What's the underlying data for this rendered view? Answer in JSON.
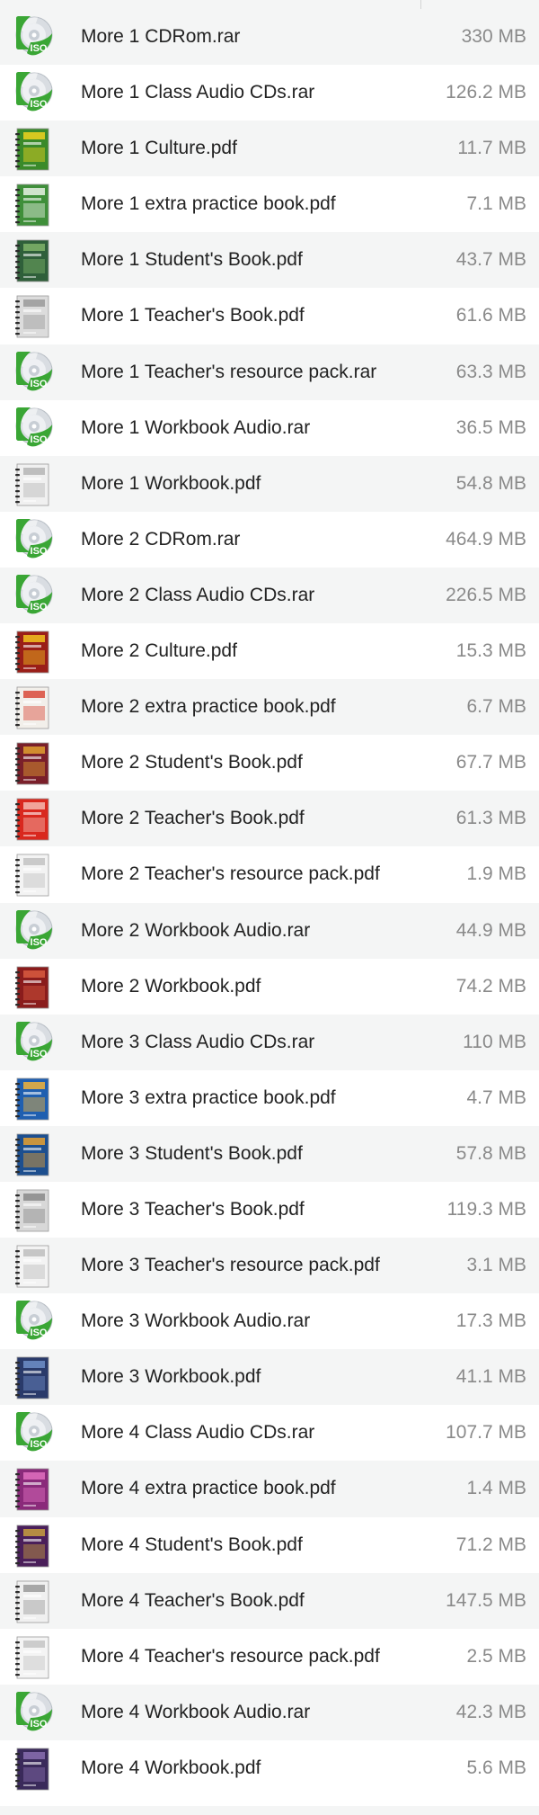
{
  "files": [
    {
      "name": "More 1 CDRom.rar",
      "size": "330 MB",
      "icon": "iso-disc-icon",
      "kind": "iso"
    },
    {
      "name": "More 1 Class Audio CDs.rar",
      "size": "126.2 MB",
      "icon": "iso-disc-icon",
      "kind": "iso"
    },
    {
      "name": "More 1 Culture.pdf",
      "size": "11.7 MB",
      "icon": "pdf-thumbnail-icon",
      "kind": "pdf",
      "color": "#3a8a2a",
      "accent": "#f2d21e"
    },
    {
      "name": "More 1 extra practice book.pdf",
      "size": "7.1 MB",
      "icon": "pdf-thumbnail-icon",
      "kind": "pdf",
      "color": "#3f8f3a",
      "accent": "#e9f2e6"
    },
    {
      "name": "More 1 Student's Book.pdf",
      "size": "43.7 MB",
      "icon": "pdf-thumbnail-icon",
      "kind": "pdf",
      "color": "#2f5f3a",
      "accent": "#7fb36a"
    },
    {
      "name": "More 1 Teacher's Book.pdf",
      "size": "61.6 MB",
      "icon": "pdf-thumbnail-icon",
      "kind": "pdf",
      "color": "#dcdcdc",
      "accent": "#9a9a9a"
    },
    {
      "name": "More 1 Teacher's resource pack.rar",
      "size": "63.3 MB",
      "icon": "iso-disc-icon",
      "kind": "iso"
    },
    {
      "name": "More 1 Workbook Audio.rar",
      "size": "36.5 MB",
      "icon": "iso-disc-icon",
      "kind": "iso"
    },
    {
      "name": "More 1 Workbook.pdf",
      "size": "54.8 MB",
      "icon": "pdf-thumbnail-icon",
      "kind": "pdf",
      "color": "#f0f0f0",
      "accent": "#b5b5b5"
    },
    {
      "name": "More 2 CDRom.rar",
      "size": "464.9 MB",
      "icon": "iso-disc-icon",
      "kind": "iso"
    },
    {
      "name": "More 2 Class Audio CDs.rar",
      "size": "226.5 MB",
      "icon": "iso-disc-icon",
      "kind": "iso"
    },
    {
      "name": "More 2 Culture.pdf",
      "size": "15.3 MB",
      "icon": "pdf-thumbnail-icon",
      "kind": "pdf",
      "color": "#9a1e18",
      "accent": "#f2c21e"
    },
    {
      "name": "More 2 extra practice book.pdf",
      "size": "6.7 MB",
      "icon": "pdf-thumbnail-icon",
      "kind": "pdf",
      "color": "#f2efea",
      "accent": "#d94a3a"
    },
    {
      "name": "More 2 Student's Book.pdf",
      "size": "67.7 MB",
      "icon": "pdf-thumbnail-icon",
      "kind": "pdf",
      "color": "#7a1f2a",
      "accent": "#e0a030"
    },
    {
      "name": "More 2 Teacher's Book.pdf",
      "size": "61.3 MB",
      "icon": "pdf-thumbnail-icon",
      "kind": "pdf",
      "color": "#d9281e",
      "accent": "#f4b9b0"
    },
    {
      "name": "More 2 Teacher's resource pack.pdf",
      "size": "1.9 MB",
      "icon": "pdf-thumbnail-icon",
      "kind": "pdf",
      "color": "#f3f3f3",
      "accent": "#c2c2c2"
    },
    {
      "name": "More 2 Workbook Audio.rar",
      "size": "44.9 MB",
      "icon": "iso-disc-icon",
      "kind": "iso"
    },
    {
      "name": "More 2 Workbook.pdf",
      "size": "74.2 MB",
      "icon": "pdf-thumbnail-icon",
      "kind": "pdf",
      "color": "#8a1c1c",
      "accent": "#d85a40"
    },
    {
      "name": "More 3 Class Audio CDs.rar",
      "size": "110 MB",
      "icon": "iso-disc-icon",
      "kind": "iso"
    },
    {
      "name": "More 3 extra practice book.pdf",
      "size": "4.7 MB",
      "icon": "pdf-thumbnail-icon",
      "kind": "pdf",
      "color": "#1f5fb0",
      "accent": "#f2b43a"
    },
    {
      "name": "More 3 Student's Book.pdf",
      "size": "57.8 MB",
      "icon": "pdf-thumbnail-icon",
      "kind": "pdf",
      "color": "#1d4f8f",
      "accent": "#e8a030"
    },
    {
      "name": "More 3 Teacher's Book.pdf",
      "size": "119.3 MB",
      "icon": "pdf-thumbnail-icon",
      "kind": "pdf",
      "color": "#d8d8d8",
      "accent": "#8a8a8a"
    },
    {
      "name": "More 3 Teacher's resource pack.pdf",
      "size": "3.1 MB",
      "icon": "pdf-thumbnail-icon",
      "kind": "pdf",
      "color": "#f3f3f3",
      "accent": "#bdbdbd"
    },
    {
      "name": "More 3 Workbook Audio.rar",
      "size": "17.3 MB",
      "icon": "iso-disc-icon",
      "kind": "iso"
    },
    {
      "name": "More 3 Workbook.pdf",
      "size": "41.1 MB",
      "icon": "pdf-thumbnail-icon",
      "kind": "pdf",
      "color": "#2a3a6a",
      "accent": "#6f8fc8"
    },
    {
      "name": "More 4 Class Audio CDs.rar",
      "size": "107.7 MB",
      "icon": "iso-disc-icon",
      "kind": "iso"
    },
    {
      "name": "More 4 extra practice book.pdf",
      "size": "1.4 MB",
      "icon": "pdf-thumbnail-icon",
      "kind": "pdf",
      "color": "#8a2a7a",
      "accent": "#e070c0"
    },
    {
      "name": "More 4 Student's Book.pdf",
      "size": "71.2 MB",
      "icon": "pdf-thumbnail-icon",
      "kind": "pdf",
      "color": "#4a1f5a",
      "accent": "#c8a040"
    },
    {
      "name": "More 4 Teacher's Book.pdf",
      "size": "147.5 MB",
      "icon": "pdf-thumbnail-icon",
      "kind": "pdf",
      "color": "#f0f0f0",
      "accent": "#9a9a9a"
    },
    {
      "name": "More 4 Teacher's resource pack.pdf",
      "size": "2.5 MB",
      "icon": "pdf-thumbnail-icon",
      "kind": "pdf",
      "color": "#f4f4f4",
      "accent": "#c4c4c4"
    },
    {
      "name": "More 4 Workbook Audio.rar",
      "size": "42.3 MB",
      "icon": "iso-disc-icon",
      "kind": "iso"
    },
    {
      "name": "More 4 Workbook.pdf",
      "size": "5.6 MB",
      "icon": "pdf-thumbnail-icon",
      "kind": "pdf",
      "color": "#3a2a5a",
      "accent": "#8a6fb0"
    }
  ],
  "colors": {
    "row_alt": "#f4f5f5",
    "name_text": "#222222",
    "size_text": "#8a8a8a",
    "iso_green": "#3aa635",
    "iso_label": "#ffffff"
  }
}
